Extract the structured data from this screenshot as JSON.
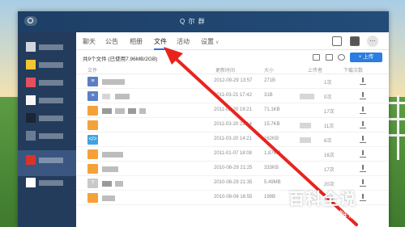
{
  "window": {
    "title": "Q 尔 群"
  },
  "tabs": [
    {
      "label": "聊天"
    },
    {
      "label": "公告"
    },
    {
      "label": "相册"
    },
    {
      "label": "文件"
    },
    {
      "label": "活动"
    },
    {
      "label": "设置"
    }
  ],
  "toolbar": {
    "more_label": "…"
  },
  "summary": "共9个文件 (已使用7.96MB/2GB)",
  "upload_label": "+ 上传",
  "columns": {
    "file": "文件",
    "time": "更新时间",
    "size": "大小",
    "uploader": "上传者",
    "downloads": "下载次数"
  },
  "files": [
    {
      "type": "doc",
      "glyph": "≡",
      "time": "2012-09-29 13:57",
      "size": "271B",
      "downloads": "1次"
    },
    {
      "type": "doc",
      "glyph": "≡",
      "time": "2011-03-21 17:42",
      "size": "31B",
      "downloads": "0次"
    },
    {
      "type": "zip",
      "glyph": "",
      "time": "2011-03-20 19:21",
      "size": "71.1KB",
      "downloads": "17次"
    },
    {
      "type": "zip",
      "glyph": "",
      "time": "2011-03-20 21:14",
      "size": "15.7KB",
      "downloads": "11次"
    },
    {
      "type": "code",
      "glyph": "</>",
      "time": "2011-03-20 14:21",
      "size": "162KB",
      "downloads": "6次"
    },
    {
      "type": "zip",
      "glyph": "",
      "time": "2011-01-07 18:08",
      "size": "1.87MB",
      "downloads": "16次"
    },
    {
      "type": "zip",
      "glyph": "",
      "time": "2010-08-29 21:25",
      "size": "333KB",
      "downloads": "17次"
    },
    {
      "type": "unk",
      "glyph": "?",
      "time": "2010-08-29 21:35",
      "size": "5.49MB",
      "downloads": "20次"
    },
    {
      "type": "zip",
      "glyph": "",
      "time": "2010-08-06 16:55",
      "size": "199B",
      "downloads": "16次"
    }
  ],
  "watermark": {
    "title": "百科全说",
    "subtitle": "助你轻松解决"
  },
  "colors": {
    "sidebar": "#243c5c",
    "accent": "#2b7de1",
    "annotation_arrow": "#e8231e"
  }
}
